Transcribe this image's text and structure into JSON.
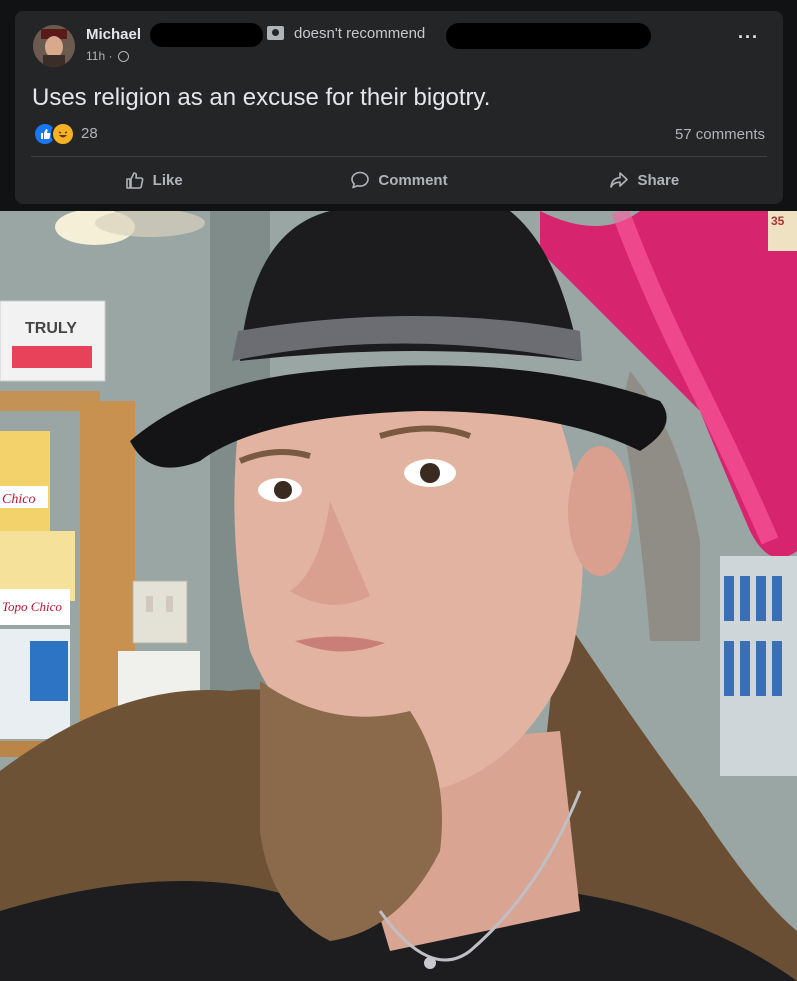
{
  "post": {
    "author": "Michael",
    "recommendation": "doesn't recommend",
    "time": "11h ·",
    "text": "Uses religion as an excuse for their bigotry.",
    "reaction_count": "28",
    "comments_count": "57 comments",
    "more_label": "···"
  },
  "actions": {
    "like": "Like",
    "comment": "Comment",
    "share": "Share"
  },
  "photo": {
    "box_brand": "TRULY",
    "box_brand_2": "Chico",
    "box_brand_3": "Topo Chico",
    "sign_number": "35"
  },
  "icons": {
    "avatar": "avatar",
    "recommend": "recommend-icon",
    "globe": "globe-icon",
    "like_reaction": "like-reaction-icon",
    "haha_reaction": "haha-reaction-icon",
    "like": "thumbs-up-icon",
    "comment": "comment-bubble-icon",
    "share": "share-arrow-icon"
  },
  "colors": {
    "card_bg": "#242526",
    "page_bg": "#111214",
    "text_primary": "#e4e6eb",
    "text_secondary": "#b0b3b8",
    "like_blue": "#1877f2",
    "haha_yellow": "#f7b125"
  }
}
